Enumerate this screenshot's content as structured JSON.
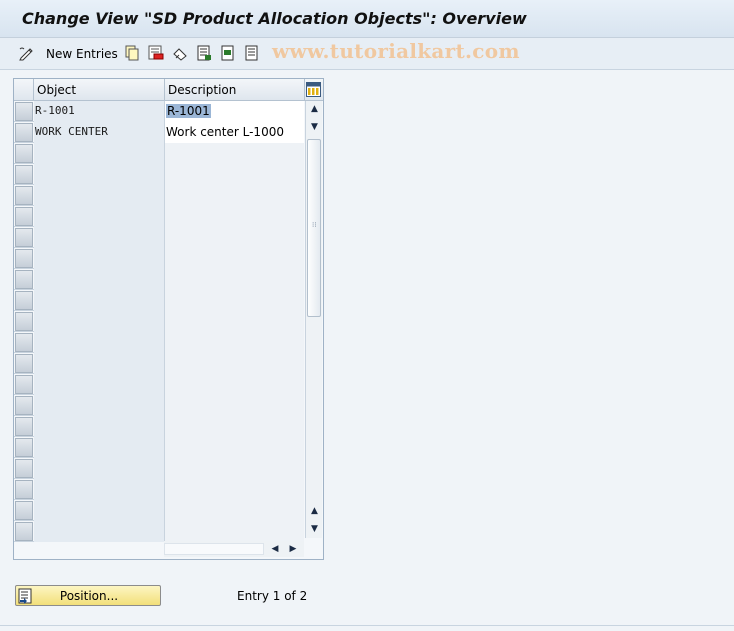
{
  "window": {
    "title": "Change View \"SD Product Allocation Objects\": Overview"
  },
  "toolbar": {
    "new_entries_label": "New Entries",
    "watermark": "www.tutorialkart.com",
    "icons": [
      "edit-pencil-icon",
      "copy-icon",
      "delete-icon",
      "undo-icon",
      "select-all-icon",
      "select-block-icon",
      "deselect-all-icon"
    ]
  },
  "table": {
    "columns": [
      "Object",
      "Description"
    ],
    "rows": [
      {
        "object": "R-1001",
        "description": "R-1001"
      },
      {
        "object": "WORK CENTER",
        "description": "Work center L-1000"
      }
    ],
    "visible_row_count": 21
  },
  "footer": {
    "position_button_label": "Position...",
    "entry_info": "Entry 1 of 2"
  },
  "colors": {
    "background": "#f0f4f8",
    "position_button": "#f2df7a",
    "highlight": "#9bb6d6"
  }
}
